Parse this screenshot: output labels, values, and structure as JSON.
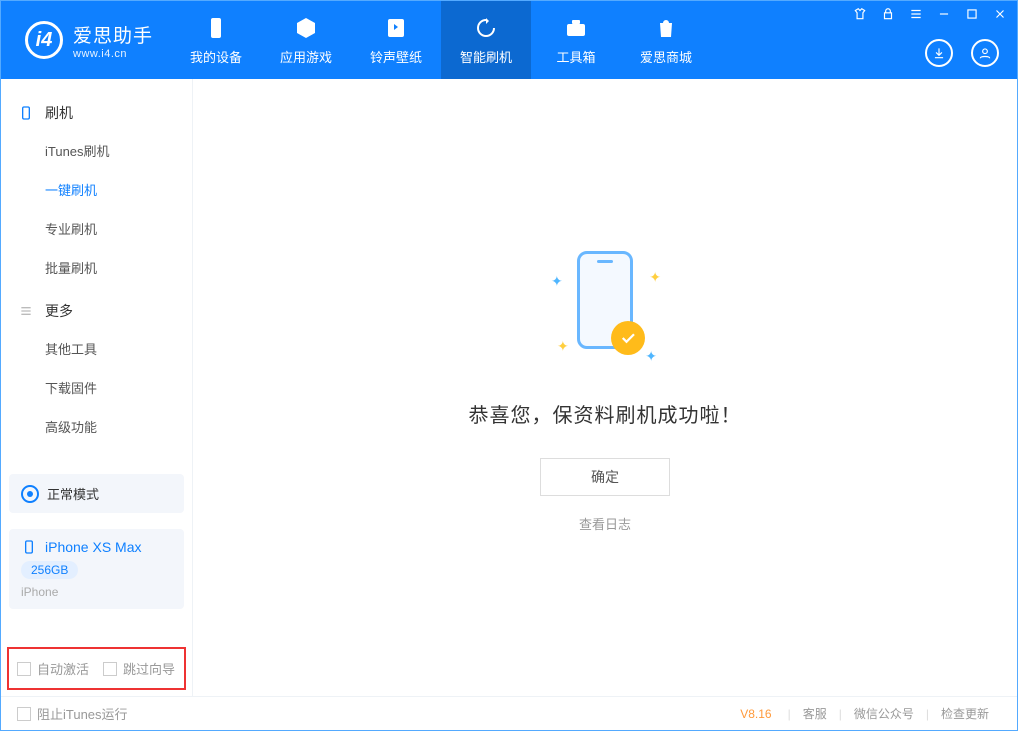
{
  "app": {
    "name_cn": "爱思助手",
    "name_en": "www.i4.cn"
  },
  "nav": {
    "items": [
      {
        "label": "我的设备",
        "icon": "device-icon"
      },
      {
        "label": "应用游戏",
        "icon": "cube-icon"
      },
      {
        "label": "铃声壁纸",
        "icon": "music-icon"
      },
      {
        "label": "智能刷机",
        "icon": "refresh-icon"
      },
      {
        "label": "工具箱",
        "icon": "toolbox-icon"
      },
      {
        "label": "爱思商城",
        "icon": "bag-icon"
      }
    ],
    "active_index": 3
  },
  "sidebar": {
    "groups": [
      {
        "title": "刷机",
        "icon": "phone-icon",
        "items": [
          "iTunes刷机",
          "一键刷机",
          "专业刷机",
          "批量刷机"
        ],
        "active_index": 1
      },
      {
        "title": "更多",
        "icon": "menu-icon",
        "items": [
          "其他工具",
          "下载固件",
          "高级功能"
        ],
        "active_index": -1
      }
    ],
    "mode_label": "正常模式",
    "device": {
      "name": "iPhone XS Max",
      "capacity": "256GB",
      "type": "iPhone"
    },
    "options": {
      "auto_activate": "自动激活",
      "skip_guide": "跳过向导",
      "auto_activate_checked": false,
      "skip_guide_checked": false
    }
  },
  "main": {
    "success_text": "恭喜您，保资料刷机成功啦！",
    "ok_label": "确定",
    "log_link": "查看日志"
  },
  "footer": {
    "block_itunes": "阻止iTunes运行",
    "block_itunes_checked": false,
    "version": "V8.16",
    "links": [
      "客服",
      "微信公众号",
      "检查更新"
    ]
  }
}
